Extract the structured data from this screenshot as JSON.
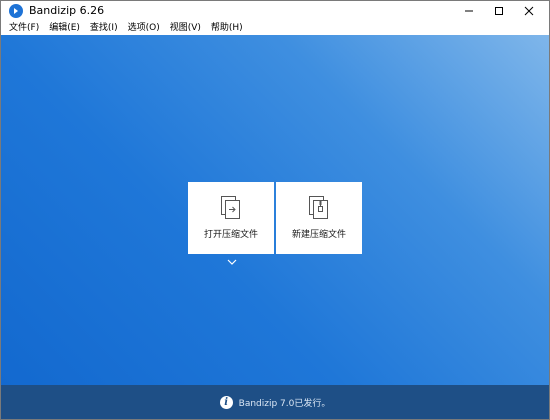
{
  "window": {
    "title": "Bandizip 6.26"
  },
  "menu": [
    {
      "label": "文件(F)"
    },
    {
      "label": "编辑(E)"
    },
    {
      "label": "查找(I)"
    },
    {
      "label": "选项(O)"
    },
    {
      "label": "视图(V)"
    },
    {
      "label": "帮助(H)"
    }
  ],
  "tiles": {
    "open": {
      "label": "打开压缩文件",
      "icon": "open-archive-icon"
    },
    "new": {
      "label": "新建压缩文件",
      "icon": "new-archive-icon"
    }
  },
  "status": {
    "text": "Bandizip 7.0已发行。",
    "icon": "info-icon"
  },
  "colors": {
    "accent": "#1f77d8",
    "statusbar": "#1e4f86"
  }
}
